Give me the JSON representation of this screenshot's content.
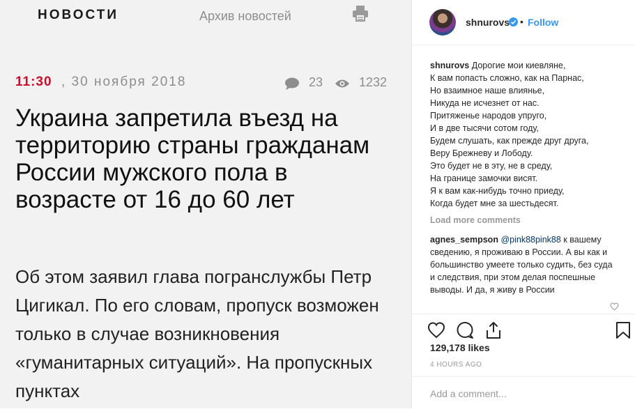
{
  "site": {
    "nav_news": "НОВОСТИ",
    "nav_archive": "Архив новостей",
    "print_icon": "printer-icon"
  },
  "article": {
    "time": "11:30",
    "date": ", 30 ноября 2018",
    "comments_count": "23",
    "views_count": "1232",
    "headline": "Украина запретила въезд на территорию страны гражданам России мужского пола в возрасте от 16 до 60 лет",
    "lead": "Об этом заявил глава погранслужбы Петр Цигикал. По его словам, пропуск возможен только в случае возникновения «гуманитарных ситуаций». На пропускных пунктах",
    "accent_color": "#c8102e"
  },
  "instagram": {
    "username": "shnurovs",
    "verified_icon": "verified-badge-icon",
    "separator": "•",
    "follow_label": "Follow",
    "follow_color": "#3897f0",
    "caption_user": "shnurovs",
    "caption_lines": [
      "Дорогие мои киевляне,",
      "К вам попасть сложно, как на Парнас,",
      "Но взаимное наше влиянье,",
      "Никуда не исчезнет от нас.",
      "Притяженье народов упруго,",
      "И в две тысячи сотом году,",
      "Будем слушать, как прежде друг друга,",
      "Веру Брежневу и Лободу.",
      "Это будет не в эту, не в среду,",
      "На границе замочки висят.",
      "Я к вам как-нибудь точно приеду,",
      "Когда будет мне за шестьдесят."
    ],
    "load_more": "Load more comments",
    "comment2_user": "agnes_sempson",
    "comment2_mention": "@pink88pink88",
    "comment2_text": "к вашему сведению, я проживаю в России. А вы как и большинство умеете только судить, без суда и следствия, при этом делая поспешные выводы. И да, я живу в России",
    "likes": "129,178 likes",
    "time_ago": "4 HOURS AGO",
    "add_comment_placeholder": "Add a comment..."
  }
}
